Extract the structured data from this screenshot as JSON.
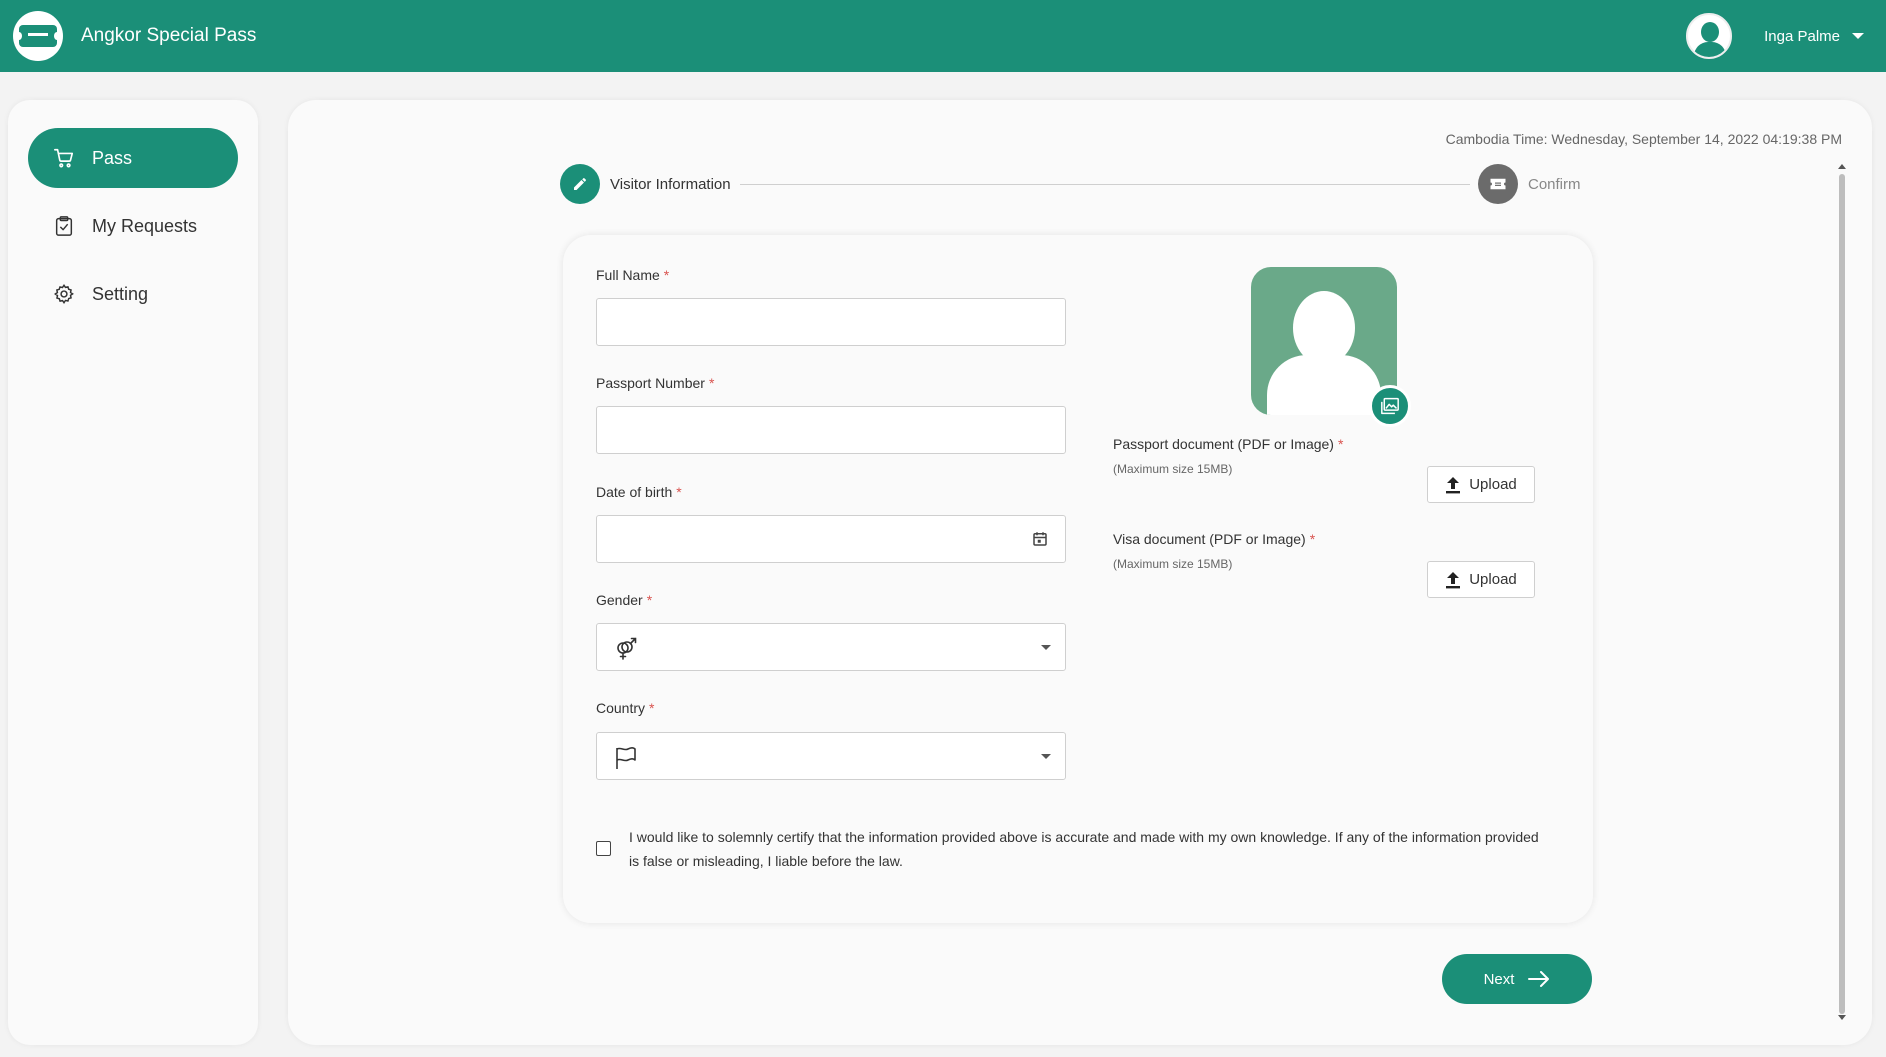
{
  "header": {
    "app_title": "Angkor Special Pass",
    "user_name": "Inga Palme"
  },
  "sidebar": {
    "items": [
      {
        "label": "Pass",
        "icon": "cart-icon",
        "active": true
      },
      {
        "label": "My Requests",
        "icon": "clipboard-icon",
        "active": false
      },
      {
        "label": "Setting",
        "icon": "gear-icon",
        "active": false
      }
    ]
  },
  "main": {
    "time_text": "Cambodia Time: Wednesday, September 14, 2022 04:19:38 PM",
    "stepper": {
      "steps": [
        {
          "label": "Visitor Information",
          "icon": "pencil-icon"
        },
        {
          "label": "Confirm",
          "icon": "ticket-icon"
        }
      ]
    },
    "form": {
      "required_mark": "*",
      "full_name": {
        "label": "Full Name",
        "value": ""
      },
      "passport_number": {
        "label": "Passport Number",
        "value": ""
      },
      "date_of_birth": {
        "label": "Date of birth",
        "value": ""
      },
      "gender": {
        "label": "Gender",
        "value": ""
      },
      "country": {
        "label": "Country",
        "value": ""
      },
      "passport_doc": {
        "label": "Passport document (PDF or Image)",
        "hint": "(Maximum size 15MB)",
        "button": "Upload"
      },
      "visa_doc": {
        "label": "Visa document (PDF or Image)",
        "hint": "(Maximum size 15MB)",
        "button": "Upload"
      },
      "certify_text": "I would like to solemnly certify that the information provided above is accurate and made with my own knowledge. If any of the information provided is false or misleading, I liable before the law."
    },
    "next_label": "Next"
  },
  "colors": {
    "brand": "#1b8f78",
    "photo_bg": "#6aa989",
    "required": "#d9534f"
  }
}
